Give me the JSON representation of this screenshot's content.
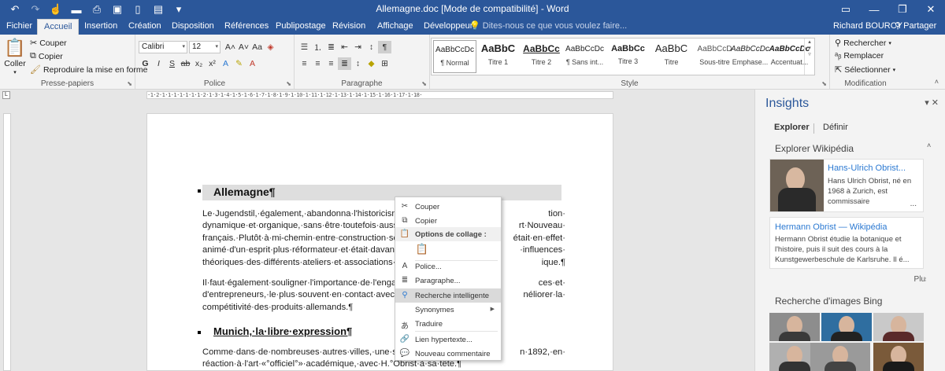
{
  "titlebar": {
    "title": "Allemagne.doc [Mode de compatibilité] - Word",
    "qat_icons": [
      "undo-icon",
      "redo-icon",
      "touch-mode-icon",
      "open-icon",
      "print-preview-icon",
      "save-icon",
      "new-document-icon",
      "format-icon",
      "customize-icon"
    ],
    "window_icons": [
      "ribbon-display-icon",
      "minimize-icon",
      "restore-icon",
      "close-icon"
    ]
  },
  "tabs": {
    "file": "Fichier",
    "home": "Accueil",
    "insert": "Insertion",
    "design": "Création",
    "layout": "Disposition",
    "references": "Références",
    "mailings": "Publipostage",
    "review": "Révision",
    "view": "Affichage",
    "developer": "Développeur",
    "tell_me": "Dites-nous ce que vous voulez faire...",
    "user": "Richard BOURCY",
    "share": "Partager"
  },
  "ribbon": {
    "clipboard": {
      "label": "Presse-papiers",
      "paste": "Coller",
      "cut": "Couper",
      "copy": "Copier",
      "format_painter": "Reproduire la mise en forme"
    },
    "font": {
      "label": "Police",
      "family": "Calibri",
      "size": "12"
    },
    "paragraph": {
      "label": "Paragraphe"
    },
    "styles": {
      "label": "Style",
      "items": [
        {
          "sample": "AaBbCcDc",
          "name": "¶ Normal"
        },
        {
          "sample": "AaBbC",
          "name": "Titre 1"
        },
        {
          "sample": "AaBbCc",
          "name": "Titre 2"
        },
        {
          "sample": "AaBbCcDc",
          "name": "¶ Sans int..."
        },
        {
          "sample": "AaBbCc",
          "name": "Titre 3"
        },
        {
          "sample": "AaBbC",
          "name": "Titre"
        },
        {
          "sample": "AaBbCcD",
          "name": "Sous-titre"
        },
        {
          "sample": "AaBbCcDc",
          "name": "Emphase..."
        },
        {
          "sample": "AaBbCcDc",
          "name": "Accentuat..."
        }
      ]
    },
    "editing": {
      "label": "Modification",
      "find": "Rechercher",
      "replace": "Remplacer",
      "select": "Sélectionner"
    }
  },
  "document": {
    "heading1": "Allemagne¶",
    "para1": [
      "Le·Jugendstil,·également,·abandonna·l'historicisme",
      "dynamique·et·organique,·sans·être·toutefois·aussi",
      "français.·Plutôt·à·mi-chemin·entre·construction·sol",
      "animé·d'un·esprit·plus·réformateur·et·était·davant",
      "théoriques·des·différents·ateliers·et·associations·c"
    ],
    "para1_right": [
      "tion·",
      "rt·Nouveau·",
      "était·en·effet·",
      "·influences·",
      "ique.¶"
    ],
    "para2": [
      "Il·faut·également·souligner·l'importance·de·l'engag",
      "d'entrepreneurs,·le·plus·souvent·en·contact·avec·l'",
      "compétitivité·des·produits·allemands.¶"
    ],
    "para2_right": [
      "ces·et·",
      "néliorer·la·",
      ""
    ],
    "heading2": "Munich,·la·libre·expression¶",
    "para3": [
      "Comme·dans·de·nombreuses·autres·villes,·une·séc",
      "réaction·à·l'art·«°officiel°»·académique,·avec·H.°Obrist·à·sa·tête.¶"
    ],
    "para3_right": [
      "n·1892,·en·",
      ""
    ]
  },
  "context_menu": {
    "cut": "Couper",
    "copy": "Copier",
    "paste_options": "Options de collage :",
    "font": "Police...",
    "paragraph": "Paragraphe...",
    "smart_lookup": "Recherche intelligente",
    "synonyms": "Synonymes",
    "translate": "Traduire",
    "hyperlink": "Lien hypertexte...",
    "new_comment": "Nouveau commentaire"
  },
  "insights": {
    "title": "Insights",
    "tab_explore": "Explorer",
    "tab_define": "Définir",
    "wiki_section": "Explorer Wikipédia",
    "card1_title": "Hans-Ulrich Obrist...",
    "card1_body": [
      "Hans Ulrich Obrist, né en",
      "1968 à Zurich, est",
      "commissaire"
    ],
    "card1_more": "...",
    "card2_title": "Hermann Obrist — Wikipédia",
    "card2_body": [
      "Hermann Obrist étudie la botanique et",
      "l'histoire, puis il suit des cours à la",
      "Kunstgewerbeschule de Karlsruhe. Il é..."
    ],
    "more": "Plus",
    "bing_section": "Recherche d'images Bing"
  },
  "colors": {
    "accent": "#2b579a",
    "link": "#2b79d2",
    "menu_hover": "#dadada"
  }
}
